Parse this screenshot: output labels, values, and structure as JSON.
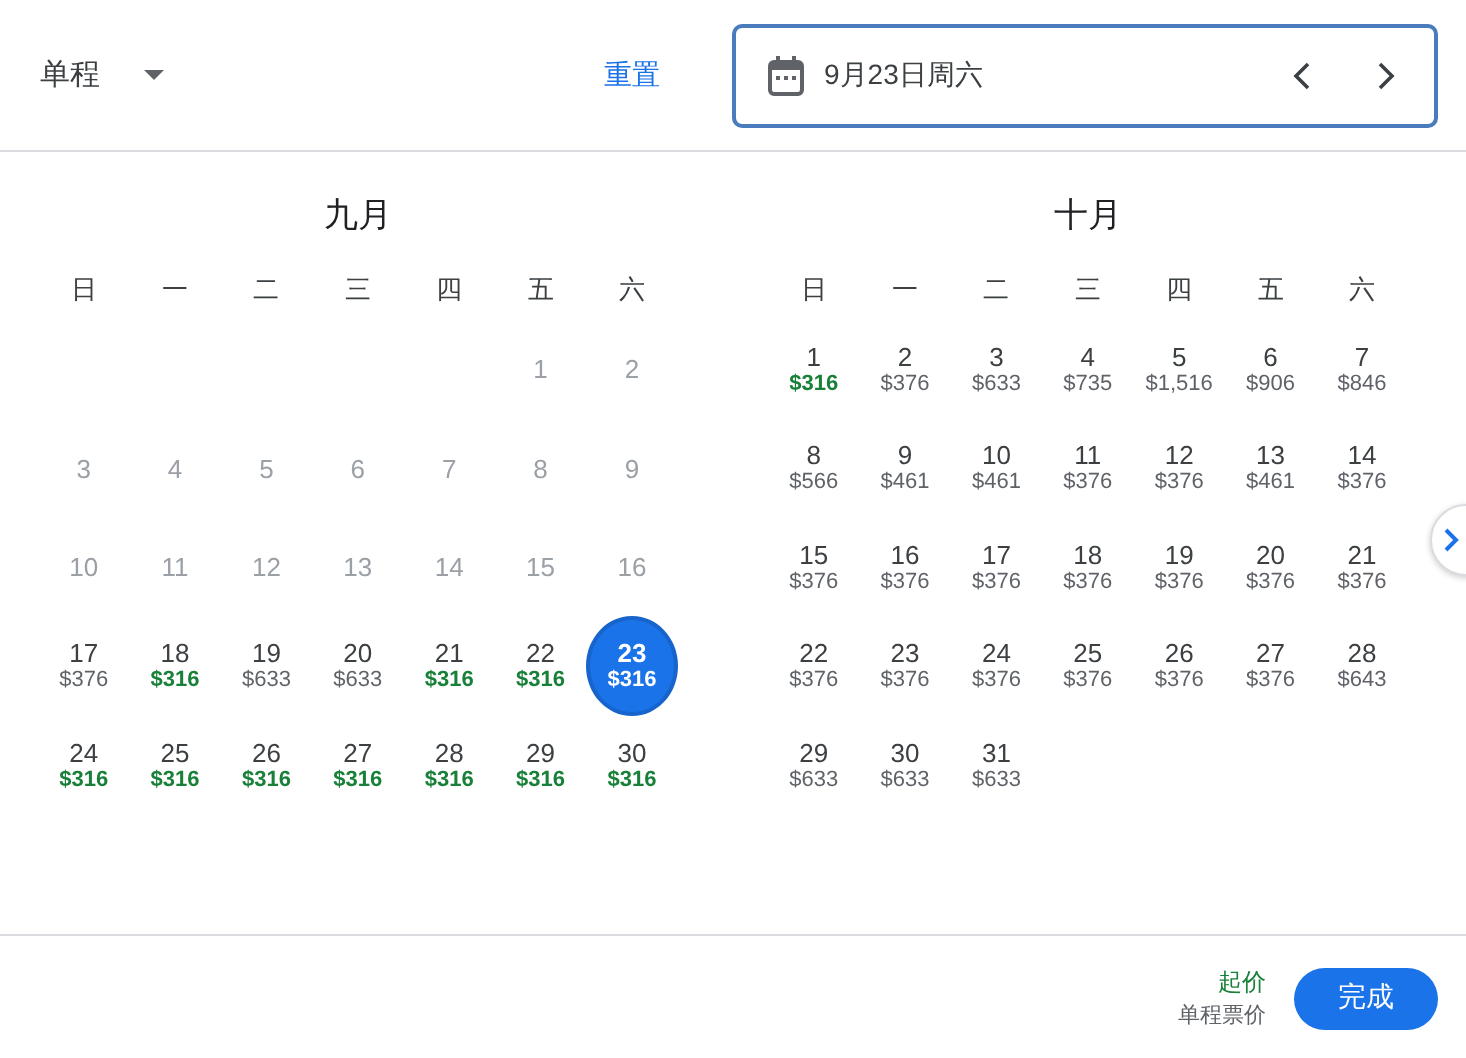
{
  "trip_type": {
    "label": "单程"
  },
  "reset": "重置",
  "date_field": {
    "value": "9月23日周六"
  },
  "months": [
    {
      "title": "九月",
      "weekdays": [
        "日",
        "一",
        "二",
        "三",
        "四",
        "五",
        "六"
      ],
      "weeks": [
        [
          {
            "kind": "blank"
          },
          {
            "kind": "blank"
          },
          {
            "kind": "blank"
          },
          {
            "kind": "blank"
          },
          {
            "kind": "blank"
          },
          {
            "kind": "day",
            "day": "1",
            "disabled": true
          },
          {
            "kind": "day",
            "day": "2",
            "disabled": true
          }
        ],
        [
          {
            "kind": "day",
            "day": "3",
            "disabled": true
          },
          {
            "kind": "day",
            "day": "4",
            "disabled": true
          },
          {
            "kind": "day",
            "day": "5",
            "disabled": true
          },
          {
            "kind": "day",
            "day": "6",
            "disabled": true
          },
          {
            "kind": "day",
            "day": "7",
            "disabled": true
          },
          {
            "kind": "day",
            "day": "8",
            "disabled": true
          },
          {
            "kind": "day",
            "day": "9",
            "disabled": true
          }
        ],
        [
          {
            "kind": "day",
            "day": "10",
            "disabled": true
          },
          {
            "kind": "day",
            "day": "11",
            "disabled": true
          },
          {
            "kind": "day",
            "day": "12",
            "disabled": true
          },
          {
            "kind": "day",
            "day": "13",
            "disabled": true
          },
          {
            "kind": "day",
            "day": "14",
            "disabled": true
          },
          {
            "kind": "day",
            "day": "15",
            "disabled": true
          },
          {
            "kind": "day",
            "day": "16",
            "disabled": true
          }
        ],
        [
          {
            "kind": "day",
            "day": "17",
            "price": "$376",
            "cheapest": false,
            "selected": false,
            "disabled": false
          },
          {
            "kind": "day",
            "day": "18",
            "price": "$316",
            "cheapest": true,
            "selected": false,
            "disabled": false
          },
          {
            "kind": "day",
            "day": "19",
            "price": "$633",
            "cheapest": false,
            "selected": false,
            "disabled": false
          },
          {
            "kind": "day",
            "day": "20",
            "price": "$633",
            "cheapest": false,
            "selected": false,
            "disabled": false
          },
          {
            "kind": "day",
            "day": "21",
            "price": "$316",
            "cheapest": true,
            "selected": false,
            "disabled": false
          },
          {
            "kind": "day",
            "day": "22",
            "price": "$316",
            "cheapest": true,
            "selected": false,
            "disabled": false
          },
          {
            "kind": "day",
            "day": "23",
            "price": "$316",
            "cheapest": true,
            "selected": true,
            "disabled": false
          }
        ],
        [
          {
            "kind": "day",
            "day": "24",
            "price": "$316",
            "cheapest": true,
            "selected": false,
            "disabled": false
          },
          {
            "kind": "day",
            "day": "25",
            "price": "$316",
            "cheapest": true,
            "selected": false,
            "disabled": false
          },
          {
            "kind": "day",
            "day": "26",
            "price": "$316",
            "cheapest": true,
            "selected": false,
            "disabled": false
          },
          {
            "kind": "day",
            "day": "27",
            "price": "$316",
            "cheapest": true,
            "selected": false,
            "disabled": false
          },
          {
            "kind": "day",
            "day": "28",
            "price": "$316",
            "cheapest": true,
            "selected": false,
            "disabled": false
          },
          {
            "kind": "day",
            "day": "29",
            "price": "$316",
            "cheapest": true,
            "selected": false,
            "disabled": false
          },
          {
            "kind": "day",
            "day": "30",
            "price": "$316",
            "cheapest": true,
            "selected": false,
            "disabled": false
          }
        ]
      ]
    },
    {
      "title": "十月",
      "weekdays": [
        "日",
        "一",
        "二",
        "三",
        "四",
        "五",
        "六"
      ],
      "weeks": [
        [
          {
            "kind": "day",
            "day": "1",
            "price": "$316",
            "cheapest": true,
            "selected": false,
            "disabled": false
          },
          {
            "kind": "day",
            "day": "2",
            "price": "$376",
            "cheapest": false,
            "selected": false,
            "disabled": false
          },
          {
            "kind": "day",
            "day": "3",
            "price": "$633",
            "cheapest": false,
            "selected": false,
            "disabled": false
          },
          {
            "kind": "day",
            "day": "4",
            "price": "$735",
            "cheapest": false,
            "selected": false,
            "disabled": false
          },
          {
            "kind": "day",
            "day": "5",
            "price": "$1,516",
            "cheapest": false,
            "selected": false,
            "disabled": false
          },
          {
            "kind": "day",
            "day": "6",
            "price": "$906",
            "cheapest": false,
            "selected": false,
            "disabled": false
          },
          {
            "kind": "day",
            "day": "7",
            "price": "$846",
            "cheapest": false,
            "selected": false,
            "disabled": false
          }
        ],
        [
          {
            "kind": "day",
            "day": "8",
            "price": "$566",
            "cheapest": false,
            "selected": false,
            "disabled": false
          },
          {
            "kind": "day",
            "day": "9",
            "price": "$461",
            "cheapest": false,
            "selected": false,
            "disabled": false
          },
          {
            "kind": "day",
            "day": "10",
            "price": "$461",
            "cheapest": false,
            "selected": false,
            "disabled": false
          },
          {
            "kind": "day",
            "day": "11",
            "price": "$376",
            "cheapest": false,
            "selected": false,
            "disabled": false
          },
          {
            "kind": "day",
            "day": "12",
            "price": "$376",
            "cheapest": false,
            "selected": false,
            "disabled": false
          },
          {
            "kind": "day",
            "day": "13",
            "price": "$461",
            "cheapest": false,
            "selected": false,
            "disabled": false
          },
          {
            "kind": "day",
            "day": "14",
            "price": "$376",
            "cheapest": false,
            "selected": false,
            "disabled": false
          }
        ],
        [
          {
            "kind": "day",
            "day": "15",
            "price": "$376",
            "cheapest": false,
            "selected": false,
            "disabled": false
          },
          {
            "kind": "day",
            "day": "16",
            "price": "$376",
            "cheapest": false,
            "selected": false,
            "disabled": false
          },
          {
            "kind": "day",
            "day": "17",
            "price": "$376",
            "cheapest": false,
            "selected": false,
            "disabled": false
          },
          {
            "kind": "day",
            "day": "18",
            "price": "$376",
            "cheapest": false,
            "selected": false,
            "disabled": false
          },
          {
            "kind": "day",
            "day": "19",
            "price": "$376",
            "cheapest": false,
            "selected": false,
            "disabled": false
          },
          {
            "kind": "day",
            "day": "20",
            "price": "$376",
            "cheapest": false,
            "selected": false,
            "disabled": false
          },
          {
            "kind": "day",
            "day": "21",
            "price": "$376",
            "cheapest": false,
            "selected": false,
            "disabled": false
          }
        ],
        [
          {
            "kind": "day",
            "day": "22",
            "price": "$376",
            "cheapest": false,
            "selected": false,
            "disabled": false
          },
          {
            "kind": "day",
            "day": "23",
            "price": "$376",
            "cheapest": false,
            "selected": false,
            "disabled": false
          },
          {
            "kind": "day",
            "day": "24",
            "price": "$376",
            "cheapest": false,
            "selected": false,
            "disabled": false
          },
          {
            "kind": "day",
            "day": "25",
            "price": "$376",
            "cheapest": false,
            "selected": false,
            "disabled": false
          },
          {
            "kind": "day",
            "day": "26",
            "price": "$376",
            "cheapest": false,
            "selected": false,
            "disabled": false
          },
          {
            "kind": "day",
            "day": "27",
            "price": "$376",
            "cheapest": false,
            "selected": false,
            "disabled": false
          },
          {
            "kind": "day",
            "day": "28",
            "price": "$643",
            "cheapest": false,
            "selected": false,
            "disabled": false
          }
        ],
        [
          {
            "kind": "day",
            "day": "29",
            "price": "$633",
            "cheapest": false,
            "selected": false,
            "disabled": false
          },
          {
            "kind": "day",
            "day": "30",
            "price": "$633",
            "cheapest": false,
            "selected": false,
            "disabled": false
          },
          {
            "kind": "day",
            "day": "31",
            "price": "$633",
            "cheapest": false,
            "selected": false,
            "disabled": false
          },
          {
            "kind": "blank"
          },
          {
            "kind": "blank"
          },
          {
            "kind": "blank"
          },
          {
            "kind": "blank"
          }
        ]
      ]
    }
  ],
  "footer": {
    "price_label": "起价",
    "note": "单程票价",
    "done": "完成"
  }
}
